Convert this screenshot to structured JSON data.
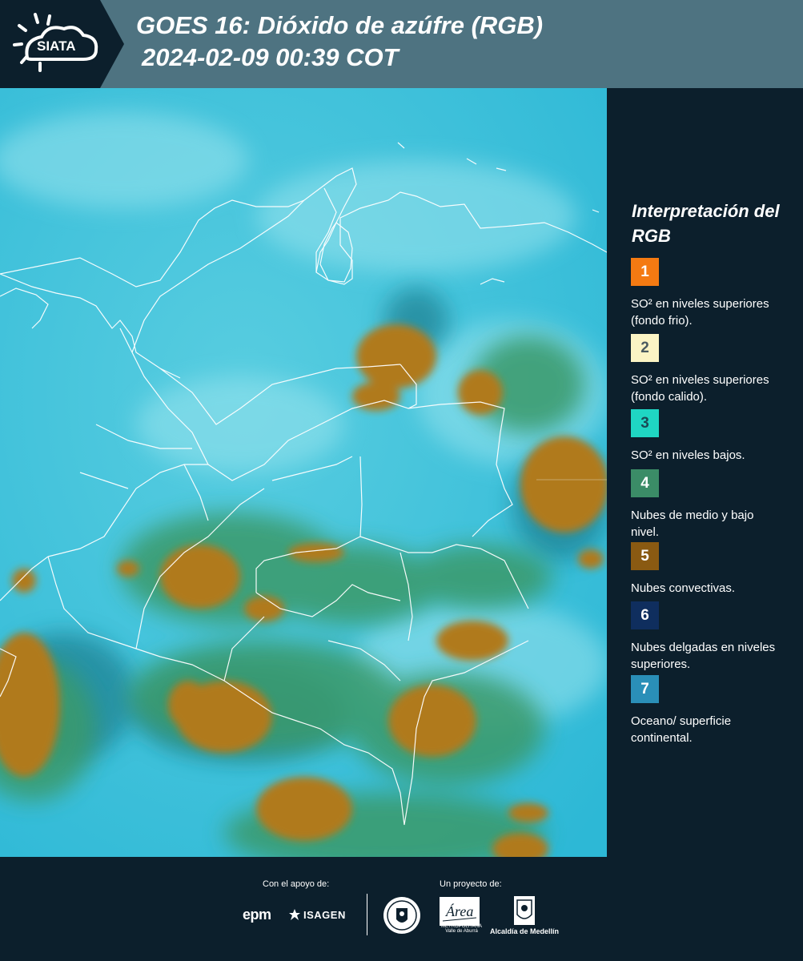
{
  "header": {
    "logo_text": "SIATA",
    "title_line1": "GOES 16: Dióxido de azúfre (RGB)",
    "title_line2": "2024-02-09 00:39 COT"
  },
  "legend": {
    "title": "Interpretación del RGB",
    "items": [
      {
        "number": "1",
        "label": "SO² en niveles superiores (fondo frio).",
        "color": "#f47a12",
        "text_color": "#ffffff"
      },
      {
        "number": "2",
        "label": "SO² en niveles superiores (fondo calido).",
        "color": "#fbf4c4",
        "text_color": "#4a5a60"
      },
      {
        "number": "3",
        "label": "SO² en niveles bajos.",
        "color": "#1fd6c3",
        "text_color": "#1a4a55"
      },
      {
        "number": "4",
        "label": "Nubes de medio y bajo nivel.",
        "color": "#3b8c67",
        "text_color": "#ffffff"
      },
      {
        "number": "5",
        "label": "Nubes convectivas.",
        "color": "#8a5a12",
        "text_color": "#ffffff"
      },
      {
        "number": "6",
        "label": "Nubes delgadas en niveles superiores.",
        "color": "#0f2e5e",
        "text_color": "#ffffff"
      },
      {
        "number": "7",
        "label": "Oceano/ superficie continental.",
        "color": "#2a8fb8",
        "text_color": "#ffffff"
      }
    ]
  },
  "footer": {
    "support_caption": "Con el apoyo de:",
    "project_caption": "Un proyecto de:",
    "epm": "epm",
    "isagen": "ISAGEN",
    "area_text": "METROPOLITANA Valle de Aburrá",
    "area_script": "Área",
    "alcaldia": "Alcaldía de Medellín"
  },
  "colors": {
    "header_bg": "#4e7381",
    "logo_bg": "#0c1f2c",
    "panel_bg": "#0c1f2c",
    "sky_cyan": "#3fc4d9",
    "convective": "#b07a1a",
    "mid_green": "#3a9a6a"
  }
}
